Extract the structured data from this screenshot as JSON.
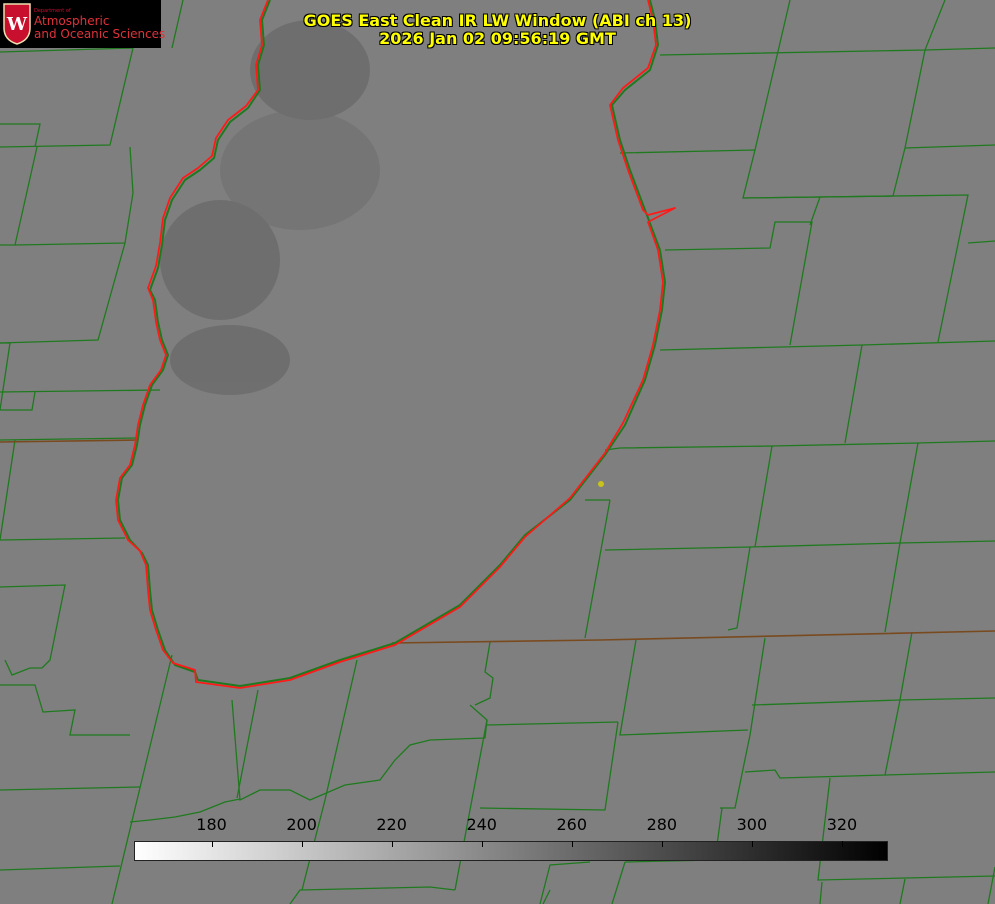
{
  "logo": {
    "department": "Department of",
    "name_line1": "Atmospheric",
    "name_line2": "and Oceanic Sciences",
    "seal_letter": "W"
  },
  "title": {
    "line1": "GOES East Clean IR LW Window (ABI ch 13)",
    "line2": "2026 Jan 02 09:56:19 GMT"
  },
  "colorbar": {
    "min": 163,
    "max": 330,
    "ticks": [
      180,
      200,
      220,
      240,
      260,
      280,
      300,
      320
    ],
    "gradient": [
      "#ffffff",
      "#000000"
    ]
  },
  "colors": {
    "background": "#7f7f7f",
    "county_lines": "#1f7a1f",
    "lake_outline": "#ff1a1a",
    "title_text": "#ffff00",
    "station_marker": "#c8c21a",
    "cloud_shade": "#6a6a6a"
  },
  "map_features": {
    "lake": "Lake Michigan",
    "station_marker": "station-dot"
  }
}
